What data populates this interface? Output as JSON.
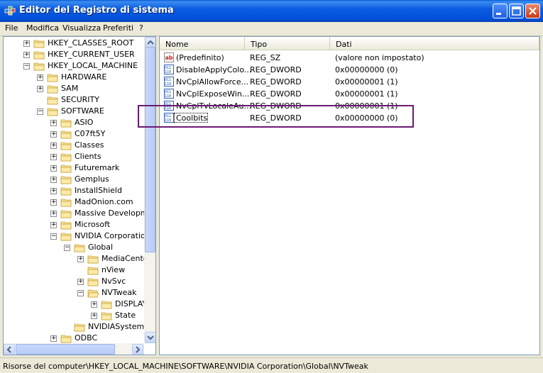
{
  "window": {
    "title": "Editor del Registro di sistema",
    "colors": {
      "title_bar": "#0054e3",
      "annotation": "#6b1a72"
    }
  },
  "menu": [
    "File",
    "Modifica",
    "Visualizza",
    "Preferiti",
    "?"
  ],
  "tree": {
    "nodes": [
      {
        "label": "HKEY_CLASSES_ROOT",
        "expander": "+"
      },
      {
        "label": "HKEY_CURRENT_USER",
        "expander": "+"
      },
      {
        "label": "HKEY_LOCAL_MACHINE",
        "expander": "-"
      },
      {
        "label": "HARDWARE",
        "expander": "+"
      },
      {
        "label": "SAM",
        "expander": "+"
      },
      {
        "label": "SECURITY",
        "expander": ""
      },
      {
        "label": "SOFTWARE",
        "expander": "-"
      },
      {
        "label": "ASIO",
        "expander": "+"
      },
      {
        "label": "C07ft5Y",
        "expander": "+"
      },
      {
        "label": "Classes",
        "expander": "+"
      },
      {
        "label": "Clients",
        "expander": "+"
      },
      {
        "label": "Futuremark",
        "expander": "+"
      },
      {
        "label": "Gemplus",
        "expander": "+"
      },
      {
        "label": "InstallShield",
        "expander": "+"
      },
      {
        "label": "MadOnion.com",
        "expander": "+"
      },
      {
        "label": "Massive Developmer",
        "expander": "+"
      },
      {
        "label": "Microsoft",
        "expander": "+"
      },
      {
        "label": "NVIDIA Corporation",
        "expander": "-"
      },
      {
        "label": "Global",
        "expander": "-"
      },
      {
        "label": "MediaCente",
        "expander": "+"
      },
      {
        "label": "nView",
        "expander": ""
      },
      {
        "label": "NvSvc",
        "expander": "+"
      },
      {
        "label": "NVTweak",
        "expander": "-"
      },
      {
        "label": "DISPLAY",
        "expander": "+"
      },
      {
        "label": "State",
        "expander": "+"
      },
      {
        "label": "NVIDIASystemU",
        "expander": ""
      },
      {
        "label": "ODBC",
        "expander": "+"
      }
    ]
  },
  "list": {
    "columns": [
      "Nome",
      "Tipo",
      "Dati"
    ],
    "rows": [
      {
        "name": "(Predefinito)",
        "type": "REG_SZ",
        "data": "(valore non impostato)",
        "icon": "string-value-icon"
      },
      {
        "name": "DisableApplyColo...",
        "type": "REG_DWORD",
        "data": "0x00000000 (0)",
        "icon": "dword-value-icon"
      },
      {
        "name": "NvCplAllowForce...",
        "type": "REG_DWORD",
        "data": "0x00000001 (1)",
        "icon": "dword-value-icon"
      },
      {
        "name": "NvCplExposeWin...",
        "type": "REG_DWORD",
        "data": "0x00000001 (1)",
        "icon": "dword-value-icon"
      },
      {
        "name": "NvCplTvLocaleAu...",
        "type": "REG_DWORD",
        "data": "0x00000001 (1)",
        "icon": "dword-value-icon"
      },
      {
        "name": "Coolbits",
        "type": "REG_DWORD",
        "data": "0x00000000 (0)",
        "icon": "dword-value-icon"
      }
    ]
  },
  "status": {
    "path": "Risorse del computer\\HKEY_LOCAL_MACHINE\\SOFTWARE\\NVIDIA Corporation\\Global\\NVTweak"
  }
}
